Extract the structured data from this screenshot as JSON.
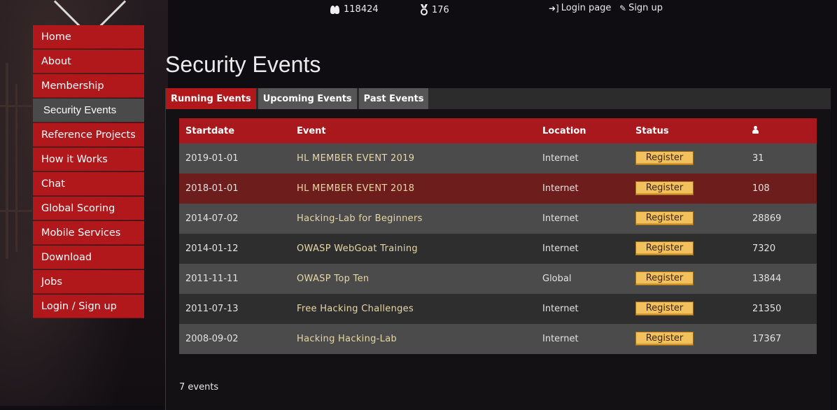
{
  "topbar": {
    "members_count": "118424",
    "awards_count": "176",
    "login_label": "Login page",
    "signup_label": "Sign up"
  },
  "sidebar": {
    "items": [
      {
        "label": "Home",
        "active": false
      },
      {
        "label": "About",
        "active": false
      },
      {
        "label": "Membership",
        "active": false
      },
      {
        "label": "Security Events",
        "active": true
      },
      {
        "label": "Reference Projects",
        "active": false
      },
      {
        "label": "How it Works",
        "active": false
      },
      {
        "label": "Chat",
        "active": false
      },
      {
        "label": "Global Scoring",
        "active": false
      },
      {
        "label": "Mobile Services",
        "active": false
      },
      {
        "label": "Download",
        "active": false
      },
      {
        "label": "Jobs",
        "active": false
      },
      {
        "label": "Login / Sign up",
        "active": false
      }
    ]
  },
  "page": {
    "title": "Security Events"
  },
  "tabs": [
    {
      "label": "Running Events",
      "active": true
    },
    {
      "label": "Upcoming Events",
      "active": false
    },
    {
      "label": "Past Events",
      "active": false
    }
  ],
  "table": {
    "headers": {
      "startdate": "Startdate",
      "event": "Event",
      "location": "Location",
      "status": "Status",
      "participants_icon": "person-icon"
    },
    "rows": [
      {
        "startdate": "2019-01-01",
        "event": "HL MEMBER EVENT 2019",
        "location": "Internet",
        "status": "Register",
        "participants": "31",
        "highlighted": false
      },
      {
        "startdate": "2018-01-01",
        "event": "HL MEMBER EVENT 2018",
        "location": "Internet",
        "status": "Register",
        "participants": "108",
        "highlighted": true
      },
      {
        "startdate": "2014-07-02",
        "event": "Hacking-Lab for Beginners",
        "location": "Internet",
        "status": "Register",
        "participants": "28869",
        "highlighted": false
      },
      {
        "startdate": "2014-01-12",
        "event": "OWASP WebGoat Training",
        "location": "Internet",
        "status": "Register",
        "participants": "7320",
        "highlighted": false
      },
      {
        "startdate": "2011-11-11",
        "event": "OWASP Top Ten",
        "location": "Global",
        "status": "Register",
        "participants": "13844",
        "highlighted": false
      },
      {
        "startdate": "2011-07-13",
        "event": "Free Hacking Challenges",
        "location": "Internet",
        "status": "Register",
        "participants": "21350",
        "highlighted": false
      },
      {
        "startdate": "2008-09-02",
        "event": "Hacking Hacking-Lab",
        "location": "Internet",
        "status": "Register",
        "participants": "17367",
        "highlighted": false
      }
    ]
  },
  "footer": {
    "events_count": "7 events"
  },
  "colors": {
    "accent_red": "#b0181c",
    "active_gray": "#4a4a4a",
    "register_yellow": "#f2c15d",
    "event_text": "#e6d7a6"
  }
}
